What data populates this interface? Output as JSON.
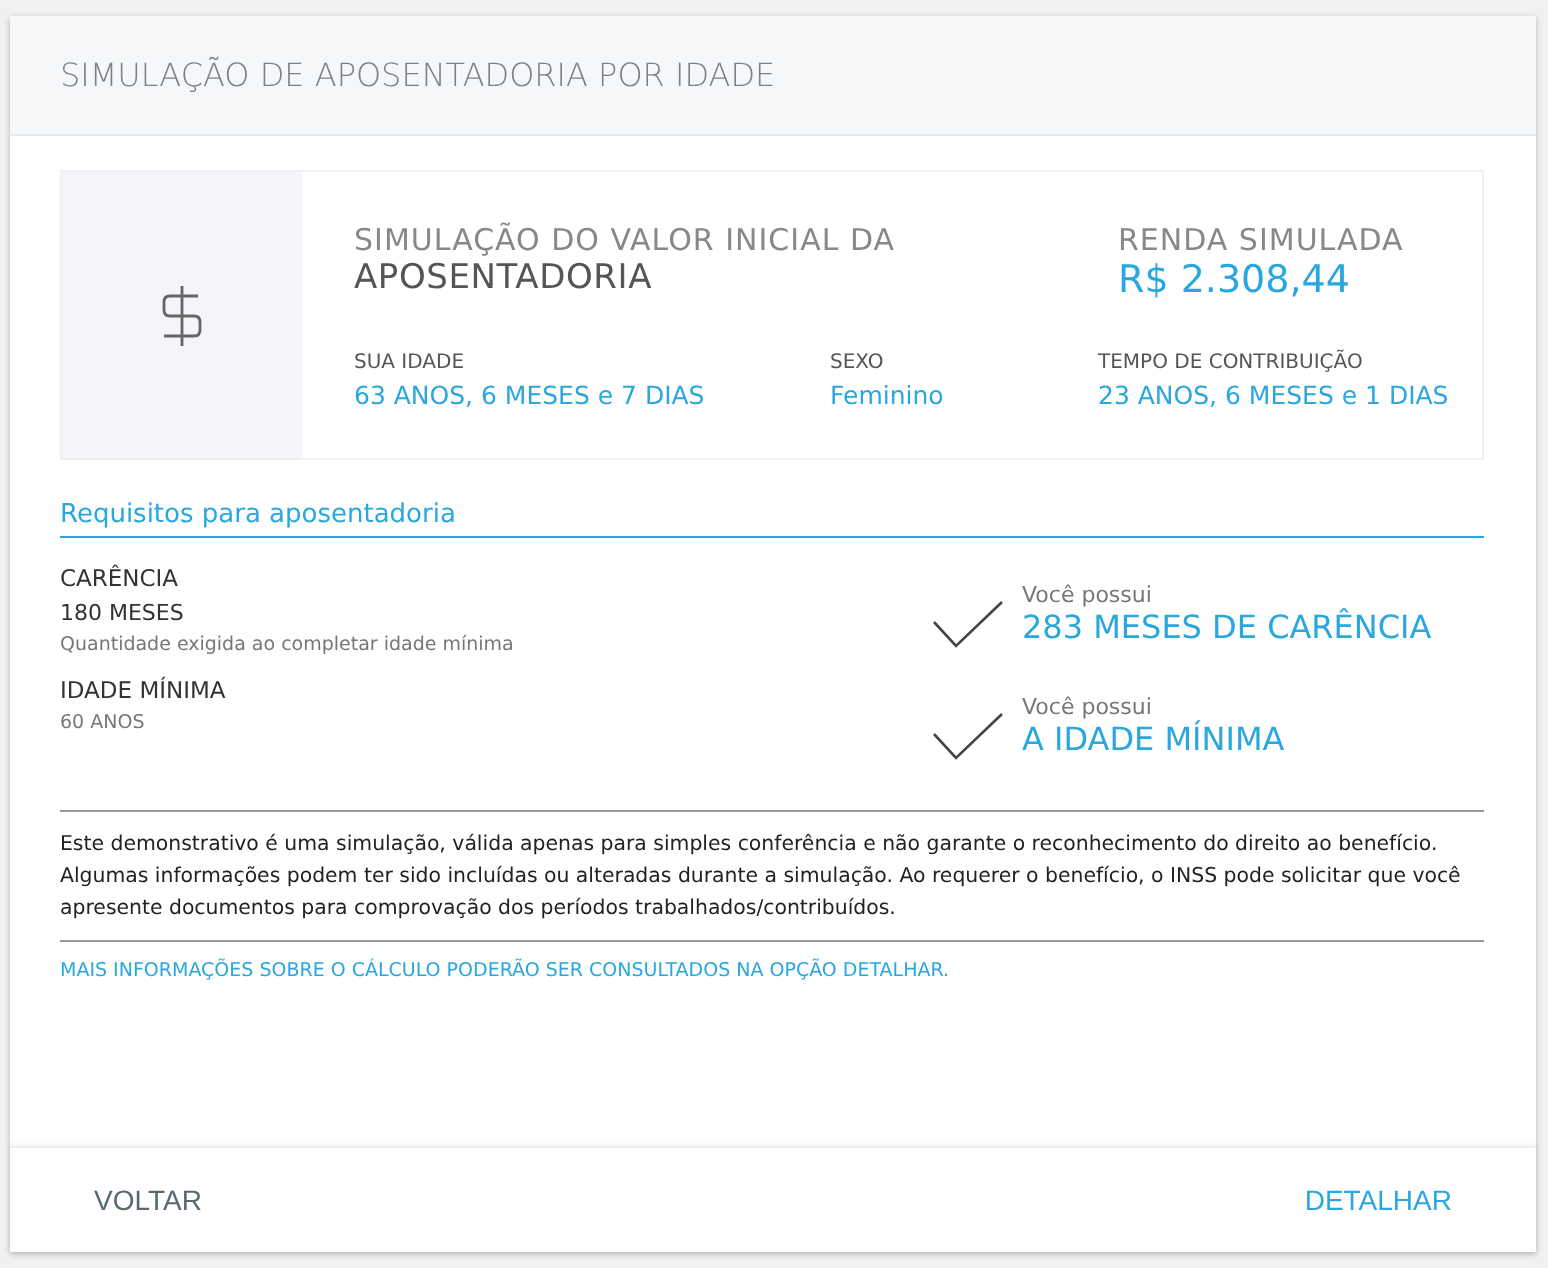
{
  "dialog": {
    "title": "SIMULAÇÃO DE APOSENTADORIA POR IDADE"
  },
  "summary": {
    "title_light": "SIMULAÇÃO DO VALOR INICIAL DA",
    "title_bold": "APOSENTADORIA",
    "income_label": "RENDA SIMULADA",
    "income_value": "R$ 2.308,44",
    "fields": [
      {
        "label": "SUA IDADE",
        "value": "63 ANOS, 6 MESES e 7 DIAS"
      },
      {
        "label": "SEXO",
        "value": "Feminino"
      },
      {
        "label": "TEMPO DE CONTRIBUIÇÃO",
        "value": "23 ANOS, 6 MESES e 1 DIAS"
      }
    ]
  },
  "requirements": {
    "heading": "Requisitos para aposentadoria",
    "items": [
      {
        "name": "CARÊNCIA",
        "value": "180 MESES",
        "note": "Quantidade exigida ao completar idade mínima",
        "met": true,
        "status_label": "Você possui",
        "status_value": "283 MESES DE CARÊNCIA"
      },
      {
        "name": "IDADE MÍNIMA",
        "note": "60 ANOS",
        "met": true,
        "status_label": "Você possui",
        "status_value": "A IDADE MÍNIMA"
      }
    ]
  },
  "disclaimer": "Este demonstrativo é uma simulação, válida apenas para simples conferência e não garante o reconhecimento do direito ao benefício. Algumas informações podem ter sido incluídas ou alteradas durante a simulação. Ao requerer o benefício, o INSS pode solicitar que você apresente documentos para comprovação dos períodos trabalhados/contribuídos.",
  "more_info": "MAIS INFORMAÇÕES SOBRE O CÁLCULO PODERÃO SER CONSULTADOS NA OPÇÃO DETALHAR.",
  "buttons": {
    "back": "VOLTAR",
    "detail": "DETALHAR"
  }
}
